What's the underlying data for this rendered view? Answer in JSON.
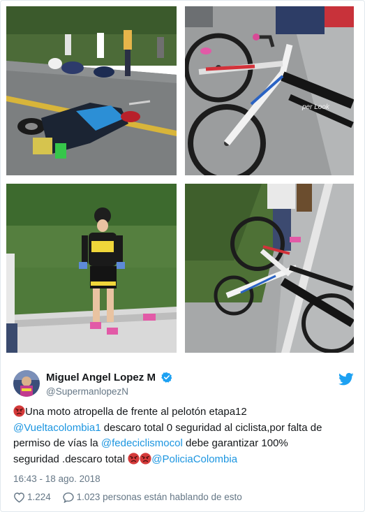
{
  "tweet": {
    "author": {
      "name": "Miguel Angel Lopez M",
      "handle": "@SupermanlopezN"
    },
    "text_parts": {
      "p1": "Una moto atropella de frente al pelotón etapa12",
      "link1": "@Vueltacolombia1",
      "p2": " descaro total 0 seguridad al ciclista,por falta de",
      "p3": "permiso de vías la ",
      "link2": "@fedeciclismocol",
      "p4": " debe garantizar 100%",
      "p5": "seguridad .descaro total ",
      "link3": "@PoliciaColombia"
    },
    "timestamp": "16:43 - 18 ago. 2018",
    "likes": "1.224",
    "replies": "1.023 personas están hablando de esto"
  },
  "photos": [
    {
      "icon": "crash-scene"
    },
    {
      "icon": "bicycle",
      "frame_text": "per Look"
    },
    {
      "icon": "cyclist"
    },
    {
      "icon": "bicycles-on-road"
    }
  ],
  "colors": {
    "link": "#1b95e0",
    "meta": "#657786",
    "verified": "#1da1f2",
    "angry_emoji": "#d43a3a"
  }
}
